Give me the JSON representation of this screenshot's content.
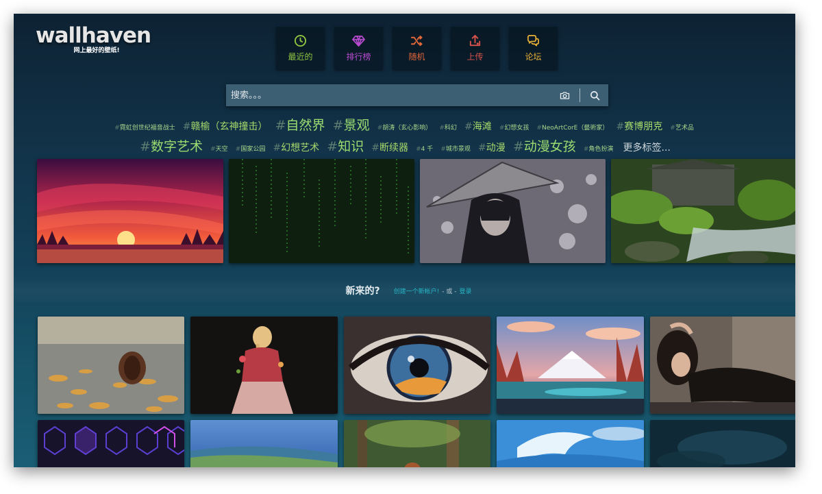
{
  "brand": {
    "logo_text": "wallhaven",
    "tagline": "网上最好的壁纸!"
  },
  "nav": [
    {
      "label": "最近的",
      "icon": "clock-icon",
      "color": "#8ec641"
    },
    {
      "label": "排行榜",
      "icon": "diamond-icon",
      "color": "#b84cd1"
    },
    {
      "label": "随机",
      "icon": "shuffle-icon",
      "color": "#e4683a"
    },
    {
      "label": "上传",
      "icon": "upload-icon",
      "color": "#d6524a"
    },
    {
      "label": "论坛",
      "icon": "chat-icon",
      "color": "#e9b236"
    }
  ],
  "search": {
    "placeholder": "搜索。。。",
    "camera_icon": "camera-icon",
    "search_icon": "search-icon"
  },
  "tags": {
    "row1": [
      {
        "text": "霓虹创世纪福音战士",
        "size": "s1"
      },
      {
        "text": "赣榆（玄神撞击）",
        "size": "s2"
      },
      {
        "text": "自然界",
        "size": "s3"
      },
      {
        "text": "景观",
        "size": "s3"
      },
      {
        "text": "胡涛（玄心影响）",
        "size": "s1"
      },
      {
        "text": "科幻",
        "size": "s1"
      },
      {
        "text": "海滩",
        "size": "s2"
      },
      {
        "text": "幻想女孩",
        "size": "s1"
      },
      {
        "text": "NeoArtCorE（藝術家）",
        "size": "s1"
      },
      {
        "text": "赛博朋克",
        "size": "s2"
      },
      {
        "text": "艺术品",
        "size": "s1"
      }
    ],
    "row2": [
      {
        "text": "数字艺术",
        "size": "s3"
      },
      {
        "text": "天空",
        "size": "s1"
      },
      {
        "text": "国家公园",
        "size": "s1"
      },
      {
        "text": "幻想艺术",
        "size": "s2"
      },
      {
        "text": "知识",
        "size": "s3"
      },
      {
        "text": "断续器",
        "size": "s2"
      },
      {
        "text": "4 千",
        "size": "s1"
      },
      {
        "text": "城市景观",
        "size": "s1"
      },
      {
        "text": "动漫",
        "size": "s2"
      },
      {
        "text": "动漫女孩",
        "size": "s3"
      },
      {
        "text": "角色扮演",
        "size": "s1"
      }
    ],
    "more": "更多标签..."
  },
  "new_banner": {
    "title": "新来的?",
    "signup": "创建一个新帐户!",
    "or": "- 或 -",
    "login": "登录"
  },
  "colors": {
    "accent_link": "#27b4c4",
    "tag_green": "#a6d86a",
    "background_top": "#0d2233",
    "background_bottom": "#1a5e75"
  }
}
